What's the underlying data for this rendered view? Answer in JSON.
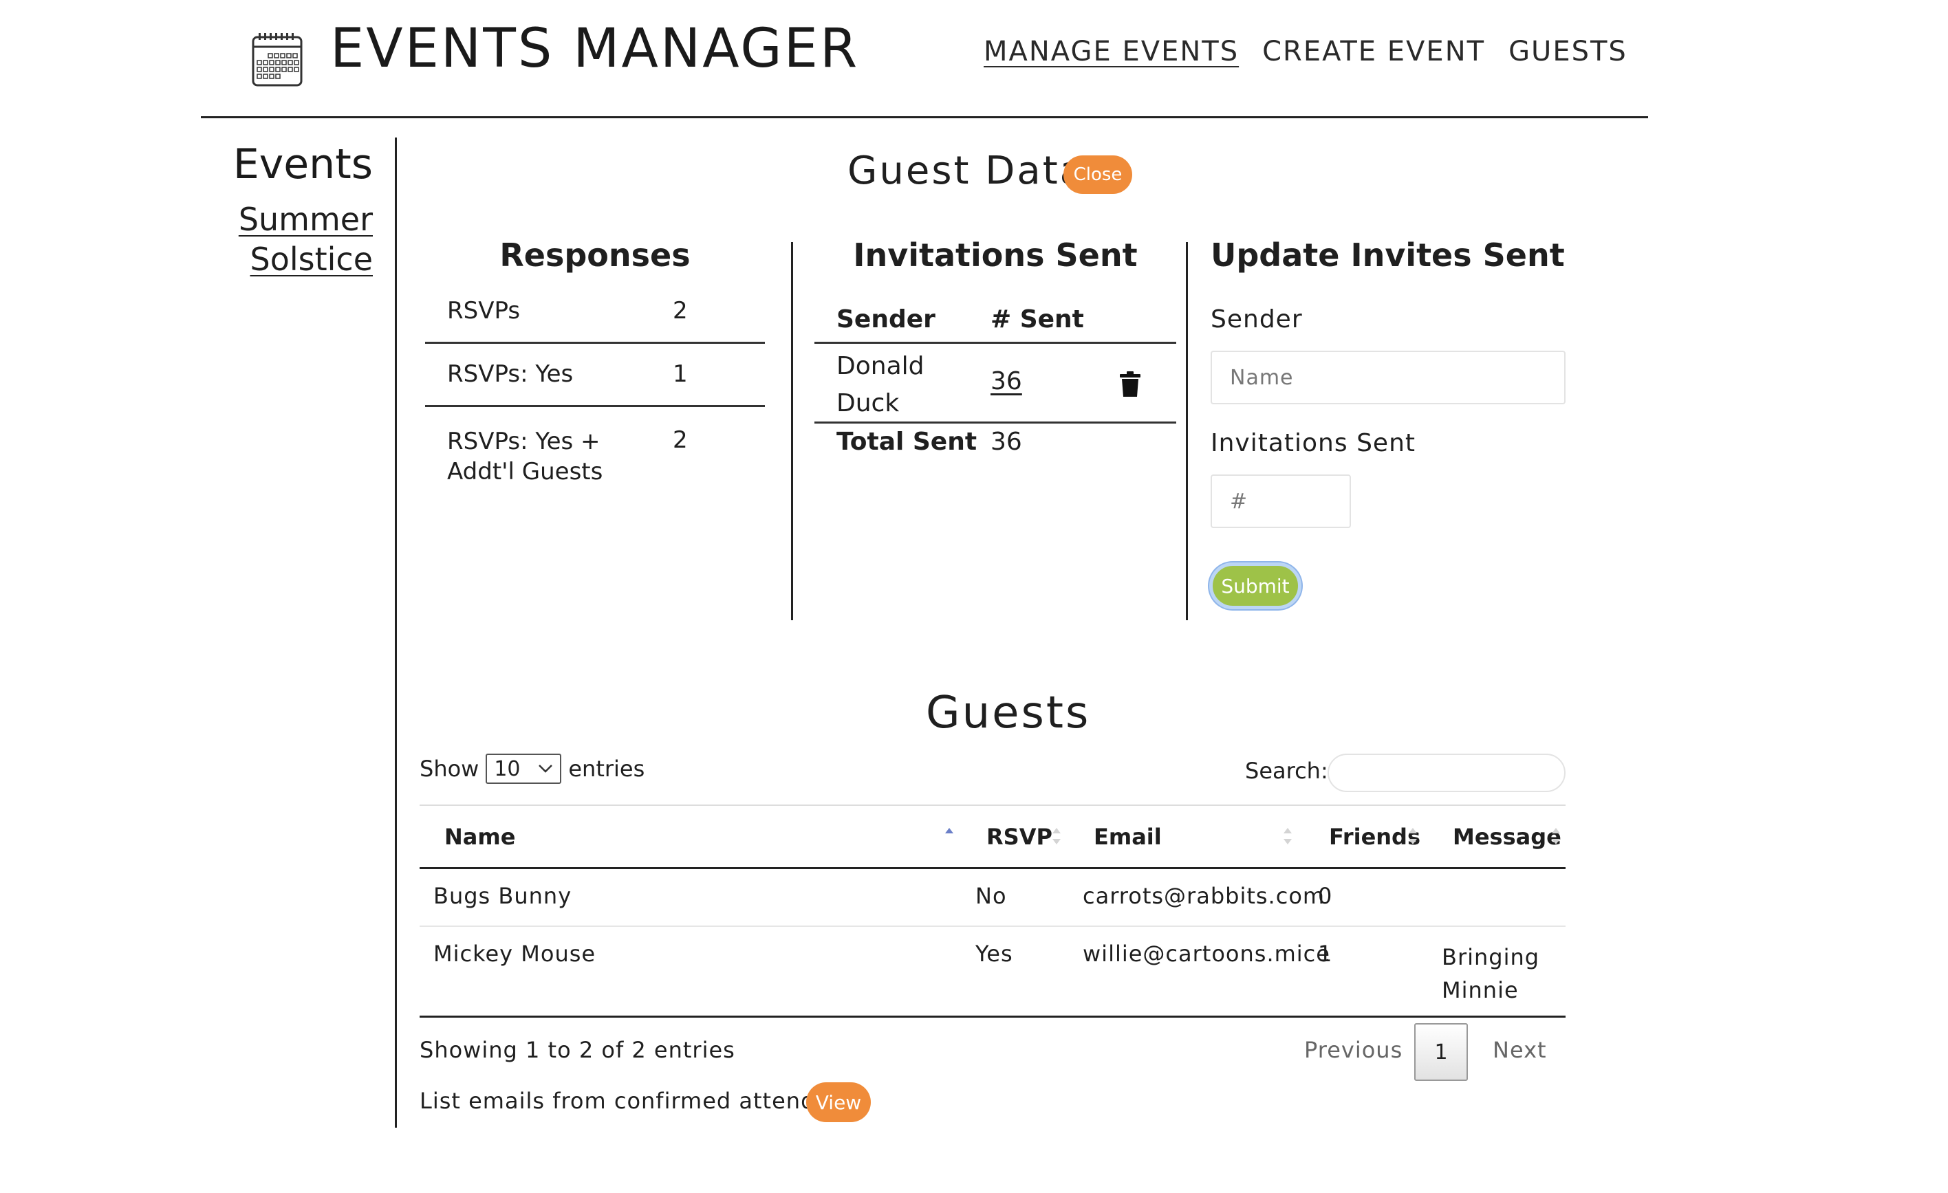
{
  "header": {
    "app_title": "EVENTS MANAGER",
    "logo_icon": "calendar-icon",
    "nav": [
      {
        "label": "MANAGE EVENTS",
        "active": true
      },
      {
        "label": "CREATE EVENT",
        "active": false
      },
      {
        "label": "GUESTS",
        "active": false
      }
    ]
  },
  "sidebar": {
    "title": "Events",
    "event_link": "Summer Solstice"
  },
  "guest_data": {
    "title": "Guest Data",
    "close_label": "Close",
    "accent_color": "#f08c3a"
  },
  "responses": {
    "title": "Responses",
    "rows": [
      {
        "label": "RSVPs",
        "value": "2"
      },
      {
        "label": "RSVPs: Yes",
        "value": "1"
      },
      {
        "label": "RSVPs: Yes + Addt'l Guests",
        "value": "2"
      }
    ]
  },
  "invitations": {
    "title": "Invitations Sent",
    "col_sender": "Sender",
    "col_sent": "# Sent",
    "rows": [
      {
        "sender": "Donald Duck",
        "sent": "36",
        "delete_icon": "trash-icon"
      }
    ],
    "total_label": "Total Sent",
    "total_value": "36"
  },
  "update_invites": {
    "title": "Update Invites Sent",
    "sender_label": "Sender",
    "sender_placeholder": "Name",
    "sent_label": "Invitations Sent",
    "sent_placeholder": "#",
    "submit_label": "Submit",
    "submit_color": "#9ec248"
  },
  "guests": {
    "title": "Guests",
    "show_label": "Show",
    "page_length": "10",
    "entries_label": "entries",
    "search_label": "Search:",
    "columns": [
      "Name",
      "RSVP",
      "Email",
      "Friends",
      "Message"
    ],
    "rows": [
      {
        "name": "Bugs Bunny",
        "rsvp": "No",
        "email": "carrots@rabbits.com",
        "friends": "0",
        "message": ""
      },
      {
        "name": "Mickey Mouse",
        "rsvp": "Yes",
        "email": "willie@cartoons.mice",
        "friends": "1",
        "message": "Bringing Minnie"
      }
    ],
    "info": "Showing 1 to 2 of 2 entries",
    "previous_label": "Previous",
    "current_page": "1",
    "next_label": "Next",
    "emails_text": "List emails from confirmed attendees",
    "view_label": "View"
  }
}
